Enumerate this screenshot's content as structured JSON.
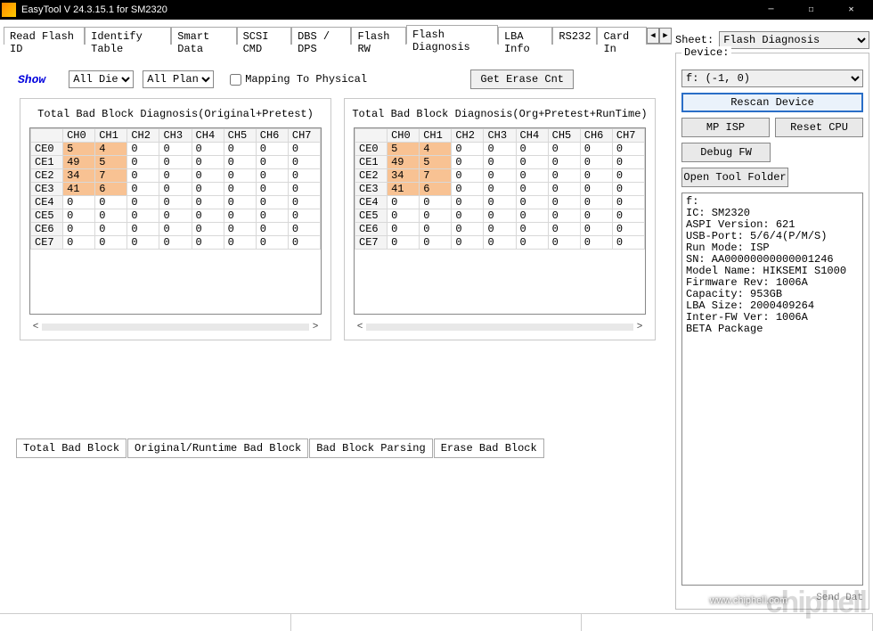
{
  "title": "EasyTool  V 24.3.15.1   for SM2320",
  "tabs": [
    "Read Flash ID",
    "Identify Table",
    "Smart Data",
    "SCSI CMD",
    "DBS / DPS",
    "Flash RW",
    "Flash Diagnosis",
    "LBA Info",
    "RS232",
    "Card In"
  ],
  "active_tab": 6,
  "controls": {
    "show": "Show",
    "die": "All Die",
    "plane": "All Plan",
    "mapping_label": "Mapping To Physical",
    "get_erase": "Get Erase Cnt"
  },
  "diag1_title": "Total Bad Block Diagnosis(Original+Pretest)",
  "diag2_title": "Total Bad Block Diagnosis(Org+Pretest+RunTime)",
  "col_headers": [
    "",
    "CH0",
    "CH1",
    "CH2",
    "CH3",
    "CH4",
    "CH5",
    "CH6",
    "CH7"
  ],
  "rows": [
    {
      "hdr": "CE0",
      "cells": [
        "5",
        "4",
        "0",
        "0",
        "0",
        "0",
        "0",
        "0"
      ],
      "hl": [
        0,
        1
      ]
    },
    {
      "hdr": "CE1",
      "cells": [
        "49",
        "5",
        "0",
        "0",
        "0",
        "0",
        "0",
        "0"
      ],
      "hl": [
        0,
        1
      ]
    },
    {
      "hdr": "CE2",
      "cells": [
        "34",
        "7",
        "0",
        "0",
        "0",
        "0",
        "0",
        "0"
      ],
      "hl": [
        0,
        1
      ]
    },
    {
      "hdr": "CE3",
      "cells": [
        "41",
        "6",
        "0",
        "0",
        "0",
        "0",
        "0",
        "0"
      ],
      "hl": [
        0,
        1
      ]
    },
    {
      "hdr": "CE4",
      "cells": [
        "0",
        "0",
        "0",
        "0",
        "0",
        "0",
        "0",
        "0"
      ],
      "hl": []
    },
    {
      "hdr": "CE5",
      "cells": [
        "0",
        "0",
        "0",
        "0",
        "0",
        "0",
        "0",
        "0"
      ],
      "hl": []
    },
    {
      "hdr": "CE6",
      "cells": [
        "0",
        "0",
        "0",
        "0",
        "0",
        "0",
        "0",
        "0"
      ],
      "hl": []
    },
    {
      "hdr": "CE7",
      "cells": [
        "0",
        "0",
        "0",
        "0",
        "0",
        "0",
        "0",
        "0"
      ],
      "hl": []
    }
  ],
  "subtabs": [
    "Total Bad Block",
    "Original/Runtime Bad Block",
    "Bad Block Parsing",
    "Erase Bad Block"
  ],
  "active_subtab": 0,
  "right": {
    "sheet_label": "Sheet:",
    "sheet_value": "Flash Diagnosis",
    "device_group": "Device:",
    "device_value": "f: (-1, 0)",
    "rescan": "Rescan Device",
    "mp_isp": "MP ISP",
    "reset_cpu": "Reset CPU",
    "debug_fw": "Debug FW",
    "open_folder": "Open Tool Folder",
    "info": "f:\nIC: SM2320\nASPI Version: 621\nUSB-Port: 5/6/4(P/M/S)\nRun Mode: ISP\nSN: AA00000000000001246\nModel Name: HIKSEMI S1000\nFirmware Rev: 1006A\nCapacity: 953GB\nLBA Size: 2000409264\nInter-FW Ver: 1006A\nBETA Package",
    "send_link": "Send Dat"
  },
  "watermark": "chiphell",
  "watermark_url": "www.chiphell.com"
}
